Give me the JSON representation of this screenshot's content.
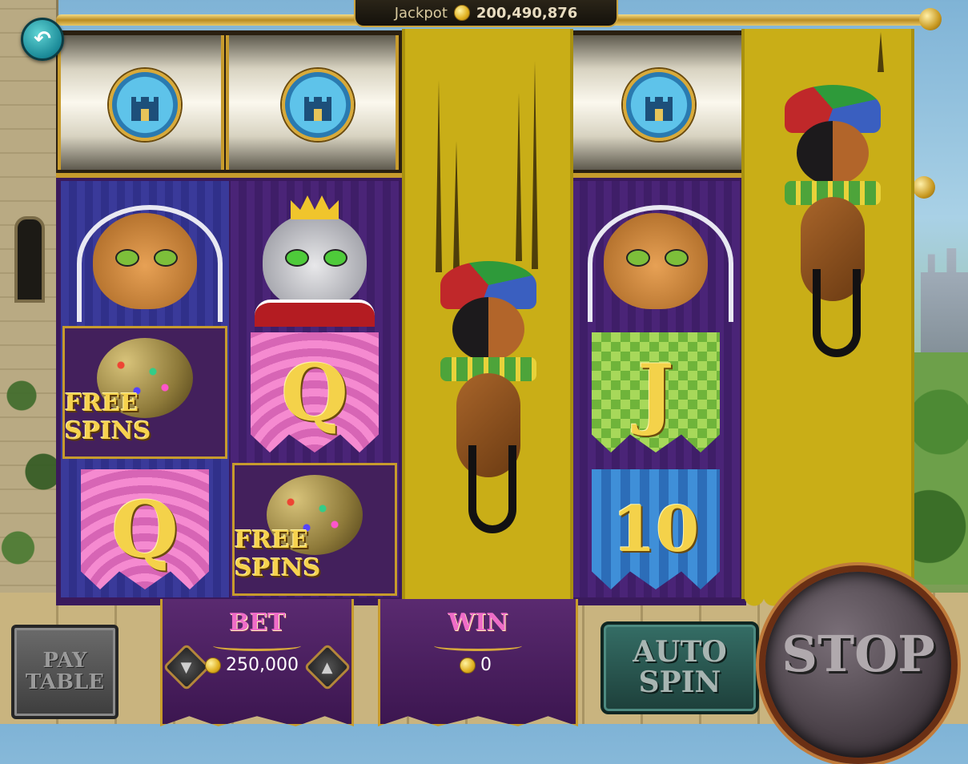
{
  "jackpot": {
    "label": "Jackpot",
    "amount": "200,490,876"
  },
  "back_button": {
    "icon": "back-arrow-icon"
  },
  "top_reels": [
    {
      "symbol": "castle-tower-icon"
    },
    {
      "symbol": "castle-tower-icon"
    },
    {
      "symbol": "jester-cat-wild"
    },
    {
      "symbol": "castle-tower-icon"
    },
    {
      "symbol": "jester-cat-wild"
    }
  ],
  "reels": {
    "col1": {
      "row1": "queen-cat",
      "row2_text": "FREE SPINS",
      "row3_letter": "Q"
    },
    "col2": {
      "row1": "king-cat",
      "row2_letter": "Q",
      "row3_text": "FREE SPINS"
    },
    "col3": {
      "symbol": "jester-cat-wild"
    },
    "col4": {
      "row1": "queen-cat",
      "row2_letter": "J",
      "row3_number": "10"
    },
    "col5": {
      "symbol": "jester-cat-wild"
    }
  },
  "controls": {
    "pay_table": [
      "PAY",
      "TABLE"
    ],
    "bet": {
      "title": "BET",
      "amount": "250,000"
    },
    "win": {
      "title": "WIN",
      "amount": "0"
    },
    "auto_spin": [
      "AUTO",
      "SPIN"
    ],
    "stop": "STOP"
  },
  "colors": {
    "gold": "#c79b2d",
    "banner_yellow": "#c9ae17",
    "reel_purple": "#4a2477",
    "win_pink": "#ef6cc7"
  }
}
